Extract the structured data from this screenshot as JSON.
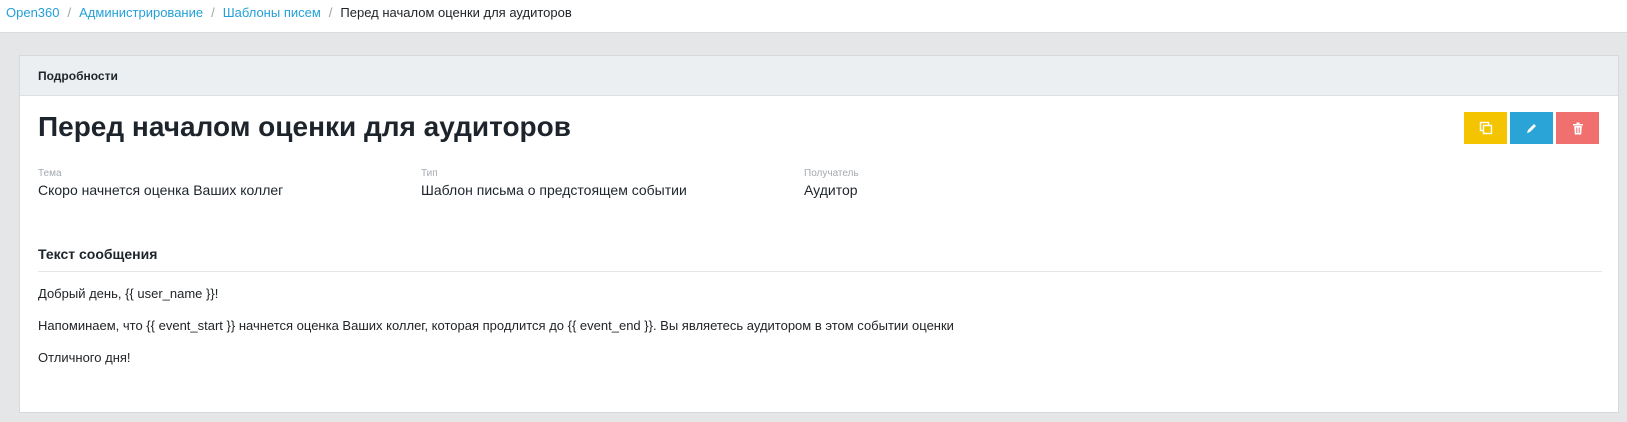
{
  "breadcrumb": {
    "items": [
      "Open360",
      "Администрирование",
      "Шаблоны писем"
    ],
    "current": "Перед началом оценки для аудиторов",
    "separator": "/"
  },
  "card": {
    "header": "Подробности",
    "title": "Перед началом оценки для аудиторов",
    "actions": {
      "copy_icon": "copy-icon",
      "edit_icon": "pencil-icon",
      "delete_icon": "trash-icon"
    },
    "fields": [
      {
        "label": "Тема",
        "value": "Скоро начнется оценка Ваших коллег"
      },
      {
        "label": "Тип",
        "value": "Шаблон письма о предстоящем событии"
      },
      {
        "label": "Получатель",
        "value": "Аудитор"
      }
    ],
    "message": {
      "title": "Текст сообщения",
      "lines": [
        "Добрый день, {{ user_name }}!",
        "Напоминаем, что {{ event_start }} начнется оценка Ваших коллег, которая продлится до {{ event_end }}. Вы являетесь аудитором в этом событии оценки",
        "Отличного дня!"
      ]
    }
  },
  "colors": {
    "link": "#23a0d9",
    "copy_button": "#f5c400",
    "edit_button": "#2aa4d6",
    "delete_button": "#f0706f"
  }
}
